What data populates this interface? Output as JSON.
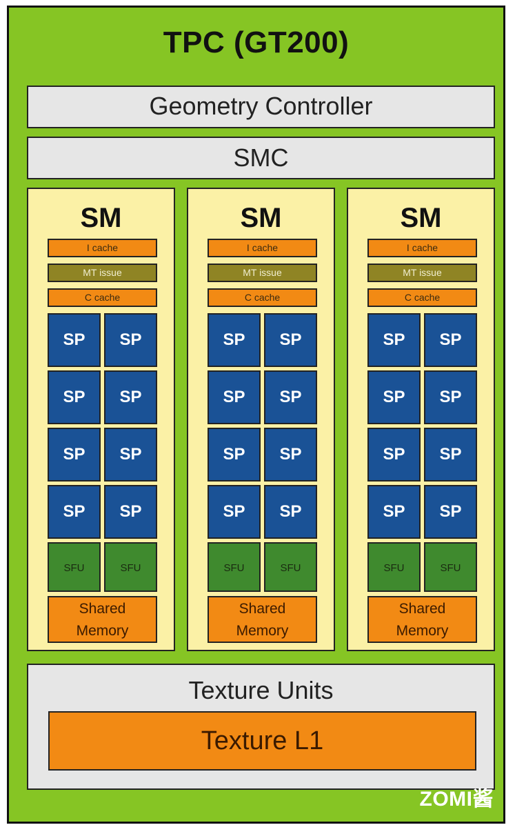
{
  "title": "TPC (GT200)",
  "geometry_controller": "Geometry Controller",
  "smc": "SMC",
  "sm_label": "SM",
  "icache_label": "I cache",
  "mt_issue_label": "MT issue",
  "ccache_label": "C cache",
  "sp_label": "SP",
  "sfu_label": "SFU",
  "shared_memory_line1": "Shared",
  "shared_memory_line2": "Memory",
  "texture_units": "Texture Units",
  "texture_l1": "Texture L1",
  "watermark": "ZOMI酱",
  "colors": {
    "tpc_background": "#86c524",
    "bar_gray": "#e6e6e6",
    "sm_background": "#fbf1a6",
    "orange": "#f28a14",
    "mt_issue": "#8f8424",
    "sp_blue": "#1a5296",
    "sfu_green": "#3f8a2e"
  }
}
